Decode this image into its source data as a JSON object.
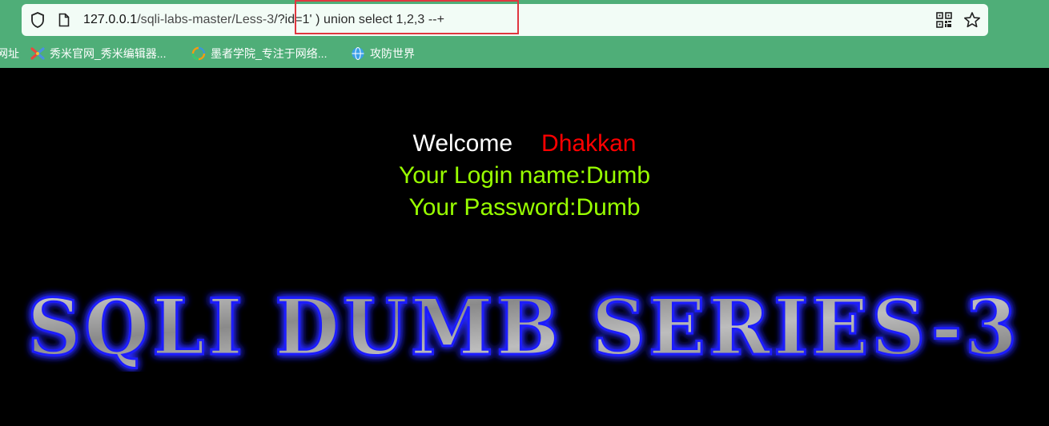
{
  "browser": {
    "url_host": "127.0.0.1",
    "url_path": "/sqli-labs-master/Less-3",
    "url_query": "/?id=1' ) union select 1,2,3 --+",
    "icons": {
      "shield": "shield-icon",
      "page": "page-icon",
      "qr": "qr-code-icon",
      "star": "star-icon"
    }
  },
  "bookmarks": [
    {
      "label": "网址",
      "icon": "none"
    },
    {
      "label": "秀米官网_秀米编辑器...",
      "icon": "xiumi-logo-icon"
    },
    {
      "label": "墨者学院_专注于网络...",
      "icon": "mozhe-logo-icon"
    },
    {
      "label": "攻防世界",
      "icon": "globe-icon"
    }
  ],
  "page": {
    "welcome": "Welcome",
    "name": "Dhakkan",
    "login_line": "Your Login name:Dumb",
    "password_line": "Your Password:Dumb",
    "banner": "SQLI DUMB SERIES-3"
  },
  "colors": {
    "toolbar": "#4fae78",
    "urlbar": "#f2fcf6",
    "highlight": "#e0363f",
    "welcome": "#ffffff",
    "name": "#ff0000",
    "result": "#99ff00",
    "background": "#000000"
  }
}
